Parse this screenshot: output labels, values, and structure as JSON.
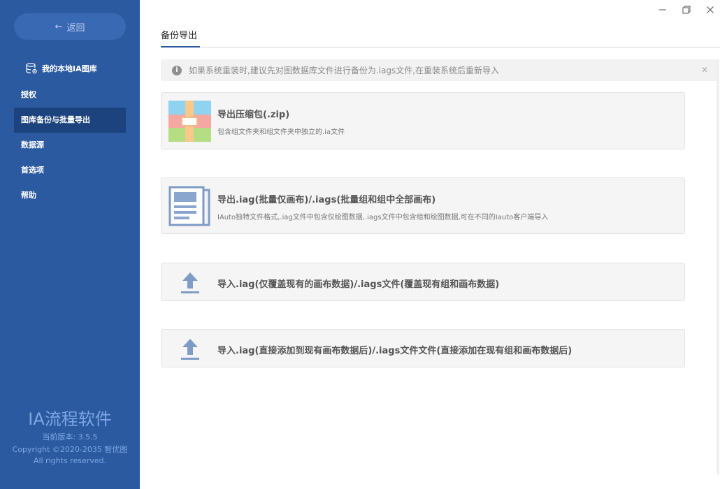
{
  "sidebar": {
    "back_label": "返回",
    "library_label": "我的本地IA图库",
    "items": [
      {
        "label": "授权"
      },
      {
        "label": "图库备份与批量导出"
      },
      {
        "label": "数据源"
      },
      {
        "label": "首选项"
      },
      {
        "label": "帮助"
      }
    ],
    "active_index": 1,
    "brand": "IA流程软件",
    "version": "当前版本: 3.5.5",
    "copyright": "Copyright ©2020-2035 智优图",
    "rights": "All rights reserved."
  },
  "tabs": [
    {
      "label": "备份导出"
    }
  ],
  "banner": {
    "text": "如果系统重装时,建议先对图数据库文件进行备份为.iags文件,在重装系统后重新导入",
    "icon": "info-icon"
  },
  "cards": [
    {
      "title": "导出压缩包(.zip)",
      "desc": "包含组文件夹和组文件夹中独立的.ia文件",
      "icon": "zip-archive-icon"
    },
    {
      "title": "导出.iag(批量仅画布)/.iags(批量组和组中全部画布)",
      "desc": "IAuto独特文件格式,.iag文件中包含仅绘图数据,.iags文件中包含组和绘图数据,可在不同的Iauto客户端导入",
      "icon": "document-icon"
    },
    {
      "title": "导入.iag(仅覆盖现有的画布数据)/.iags文件(覆盖现有组和画布数据)",
      "icon": "upload-icon"
    },
    {
      "title": "导入.iag(直接添加到现有画布数据后)/.iags文件文件(直接添加在现有组和画布数据后)",
      "icon": "upload-icon"
    }
  ],
  "colors": {
    "sidebar_bg": "#2c5aa0",
    "sidebar_active": "#1d437f",
    "accent": "#2c5aa0"
  }
}
